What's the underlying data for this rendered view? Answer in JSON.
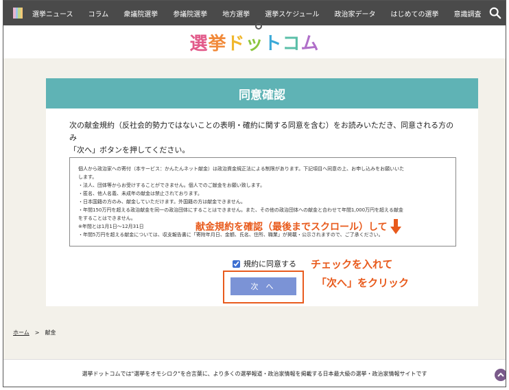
{
  "nav": {
    "items": [
      "選挙ニュース",
      "コラム",
      "衆議院選挙",
      "参議院選挙",
      "地方選挙",
      "選挙スケジュール",
      "政治家データ",
      "はじめての選挙",
      "意識調査"
    ],
    "logo_colors": [
      "#e8b6d0",
      "#9fc6e8",
      "#c3d889",
      "#f3c878"
    ]
  },
  "site_logo": {
    "chars": [
      "選",
      "挙",
      "ド",
      "ッ",
      "ト",
      "コ",
      "ム"
    ],
    "colors": [
      "#e25a8a",
      "#f18a3a",
      "#f0b72d",
      "#8cc63f",
      "#3aa9d8",
      "#5bbfa8",
      "#b06fc9"
    ]
  },
  "card": {
    "title": "同意確認",
    "intro_line1": "次の献金規約（反社会的勢力ではないことの表明・確約に関する同意を含む）をお読みいただき、同意される方のみ",
    "intro_line2": "「次へ」ボタンを押してください。",
    "terms": [
      "個人から政治家への寄付（本サービス：かんたんネット献金）は政治資金規正法による制限があります。下記項目へ同意の上、お申し込みをお願いいた",
      "します。",
      "・法人、団体等からお受けすることができません。個人でのご献金をお願い致します。",
      "・匿名、他人名義、未成年の献金は禁止されております。",
      "・日本国籍の方のみ、献金していただけます。外国籍の方は献金できません。",
      "・年間150万円を超える政治献金を同一の政治団体にすることはできません。また、その他の政治団体への献金と合わせて年間1,000万円を超える献金",
      "をすることはできません。",
      "※年間とは1月1日〜12月31日",
      "・年間5万円を超える献金については、収支報告書に「寄附年月日、金額、氏名、住所、職業」が掲載・公示されますので、ご了承ください。"
    ],
    "agree_label": "規約に同意する",
    "next_label": "次 へ"
  },
  "annotations": {
    "scroll_hint": "献金規約を確認（最後までスクロール）して",
    "check_line1": "チェックを入れて",
    "check_line2": "「次へ」をクリック",
    "color": "#e85a1c"
  },
  "breadcrumb": {
    "home": "ホーム",
    "separator": ">",
    "current": "献金"
  },
  "footer": {
    "text": "選挙ドットコムでは\"選挙をオモシロク\"を合言葉に、より多くの選挙報道・政治家情報を掲載する日本最大級の選挙・政治家情報サイトです"
  }
}
